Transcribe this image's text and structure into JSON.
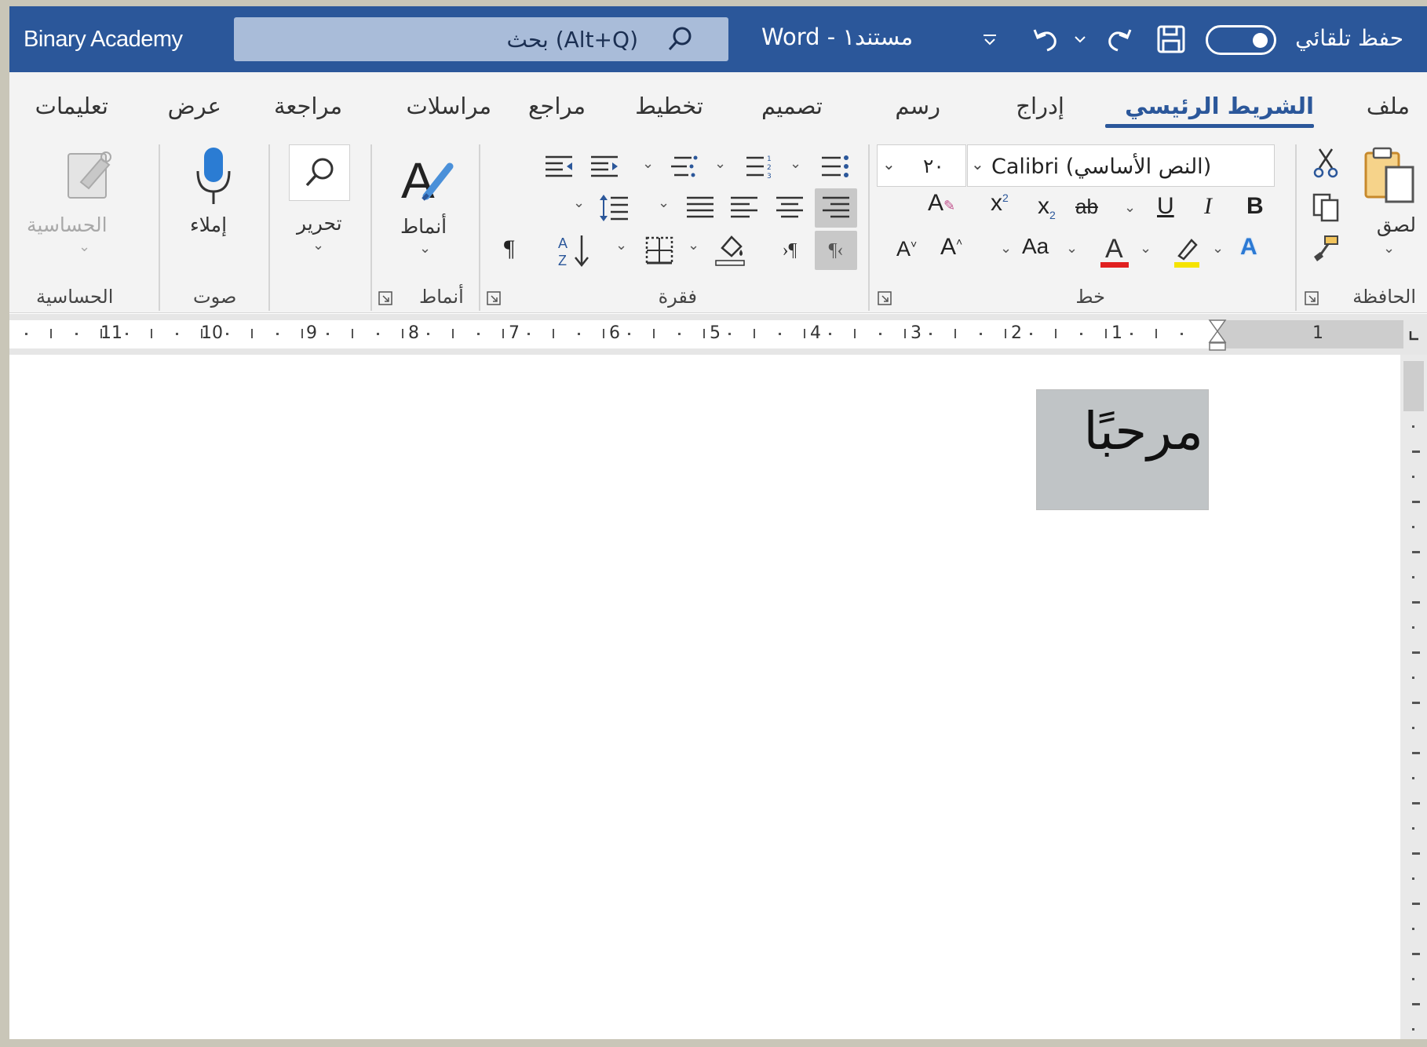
{
  "titlebar": {
    "account": "Binary Academy",
    "search_text": "(Alt+Q) بحث",
    "doc_title": "Word  -  مستند١",
    "autosave_label": "حفظ تلقائي",
    "accent": "#2b579a"
  },
  "tabs": [
    "ملف",
    "الشريط الرئيسي",
    "إدراج",
    "رسم",
    "تصميم",
    "تخطيط",
    "مراجع",
    "مراسلات",
    "مراجعة",
    "عرض",
    "تعليمات"
  ],
  "ribbon": {
    "clipboard": {
      "paste_label": "لصق",
      "group_label": "الحافظة"
    },
    "font": {
      "font_name": "Calibri (النص الأساسي)",
      "font_size": "٢٠",
      "change_case": "Aa",
      "group_label": "خط"
    },
    "paragraph": {
      "group_label": "فقرة"
    },
    "styles": {
      "styles_label": "أنماط",
      "group_label": "أنماط"
    },
    "editing": {
      "editing_label": "تحرير"
    },
    "voice": {
      "dictate_label": "إملاء",
      "group_label": "صوت"
    },
    "sensitivity": {
      "sensitivity_label": "الحساسية",
      "group_label": "الحساسية"
    }
  },
  "ruler": {
    "numbers": [
      "1",
      "1",
      "2",
      "3",
      "4",
      "5",
      "6",
      "7",
      "8",
      "9",
      "10",
      "11"
    ]
  },
  "document": {
    "text": "مرحبًا",
    "textbox_color": "#c0c4c6"
  }
}
